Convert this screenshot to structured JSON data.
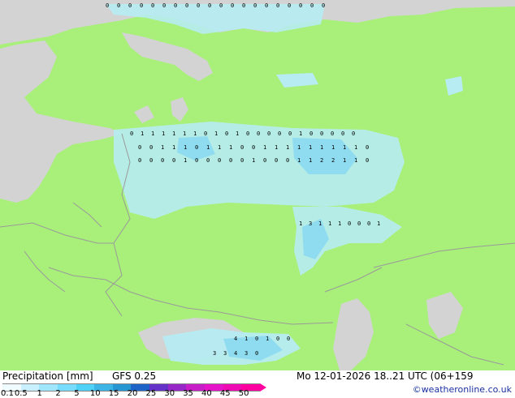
{
  "footer": {
    "title": "Precipitation [mm]",
    "model": "GFS 0.25",
    "datetime": "Mo 12-01-2026 18..21 UTC (06+159",
    "copyright": "©weatheronline.co.uk"
  },
  "legend": {
    "labels": [
      "0.1",
      "0.5",
      "1",
      "2",
      "5",
      "10",
      "15",
      "20",
      "25",
      "30",
      "35",
      "40",
      "45",
      "50"
    ],
    "colors": [
      "#f0fbff",
      "#c8f0ff",
      "#a0e6ff",
      "#78dcff",
      "#50d2f8",
      "#3cb4e6",
      "#2896d2",
      "#1e64c8",
      "#6432c8",
      "#9628c8",
      "#c81ec8",
      "#e614c8",
      "#f00ab4",
      "#ff00a0"
    ]
  },
  "map": {
    "land_color": "#a8f07a",
    "water_color": "#d3d3d3",
    "border_color": "#9a9a9a",
    "precip_light": "#b6ecf2",
    "precip_medium": "#8fdcf0",
    "grid_values": [
      {
        "row": "top",
        "values": [
          "0",
          "0",
          "0",
          "0",
          "0",
          "0",
          "0",
          "0",
          "0",
          "0",
          "0",
          "0",
          "0",
          "0",
          "0",
          "0",
          "0",
          "0",
          "0",
          "0"
        ]
      },
      {
        "row": "a",
        "values": [
          "0",
          "1",
          "1",
          "1",
          "1",
          "1",
          "1",
          "0",
          "1",
          "0",
          "1",
          "0",
          "0",
          "0",
          "0",
          "0",
          "1",
          "0",
          "0",
          "0",
          "0",
          "0"
        ]
      },
      {
        "row": "b",
        "values": [
          "0",
          "0",
          "1",
          "1",
          "1",
          "0",
          "1",
          "1",
          "1",
          "0",
          "0",
          "1",
          "1",
          "1",
          "1",
          "1",
          "1",
          "1",
          "1",
          "1",
          "0"
        ]
      },
      {
        "row": "c",
        "values": [
          "0",
          "0",
          "0",
          "0",
          "1",
          "0",
          "0",
          "0",
          "0",
          "0",
          "1",
          "0",
          "0",
          "0",
          "1",
          "1",
          "2",
          "2",
          "1",
          "1",
          "0"
        ]
      },
      {
        "row": "d",
        "values": [
          "1",
          "3",
          "1",
          "1",
          "1",
          "0",
          "0",
          "0",
          "1"
        ]
      },
      {
        "row": "e",
        "values": [
          "4",
          "1",
          "0",
          "1",
          "0",
          "0"
        ]
      },
      {
        "row": "f",
        "values": [
          "3",
          "3",
          "4",
          "3",
          "0"
        ]
      }
    ]
  }
}
